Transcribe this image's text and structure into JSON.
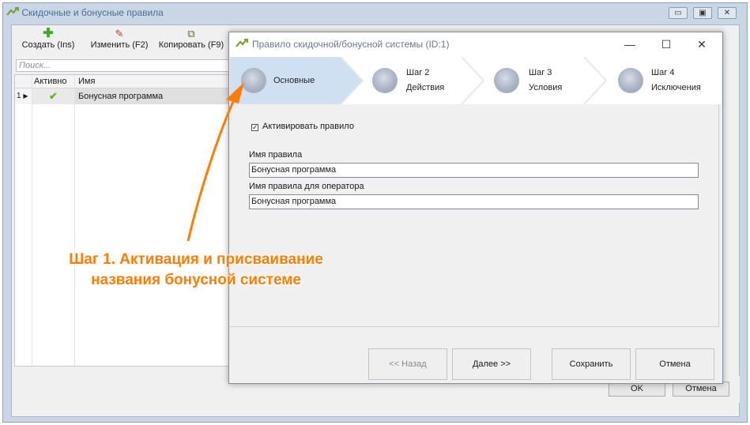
{
  "bg_window": {
    "title": "Скидочные и бонусные правила",
    "controls": [
      "▭",
      "▣",
      "✕"
    ]
  },
  "toolbar": {
    "create": {
      "label": "Создать (Ins)",
      "icon": "+"
    },
    "edit": {
      "label": "Изменить (F2)",
      "icon": "✎"
    },
    "copy": {
      "label": "Копировать (F9)",
      "icon": "⧉"
    }
  },
  "search": {
    "placeholder": "Поиск..."
  },
  "grid": {
    "columns": [
      "Активно",
      "Имя"
    ],
    "rows": [
      {
        "num": "1",
        "active": "✔",
        "name": "Бонусная программа"
      }
    ]
  },
  "bg_buttons": {
    "ok": "OK",
    "cancel": "Отмена"
  },
  "dialog": {
    "title": "Правило скидочной/бонусной системы (ID:1)",
    "controls": {
      "minimize": "—",
      "maximize": "☐",
      "close": "✕"
    },
    "steps": [
      {
        "step": "",
        "name": "Основные",
        "active": true
      },
      {
        "step": "Шаг 2",
        "name": "Действия",
        "active": false
      },
      {
        "step": "Шаг 3",
        "name": "Условия",
        "active": false
      },
      {
        "step": "Шаг 4",
        "name": "Исключения",
        "active": false
      }
    ],
    "activate_label": "Активировать правило",
    "activate_checked": true,
    "rule_name_label": "Имя правила",
    "rule_name_value": "Бонусная программа",
    "operator_name_label": "Имя правила для оператора",
    "operator_name_value": "Бонусная программа",
    "buttons": {
      "back": "<< Назад",
      "next": "Далее >>",
      "save": "Сохранить",
      "cancel": "Отмена"
    }
  },
  "annotation": {
    "line1": "Шаг 1. Активация и присваивание",
    "line2": "названия бонусной системе",
    "color": "#ff7e00"
  },
  "colors": {
    "active_step": "#cfe0f3",
    "titlebar_text": "#4a6f96"
  }
}
